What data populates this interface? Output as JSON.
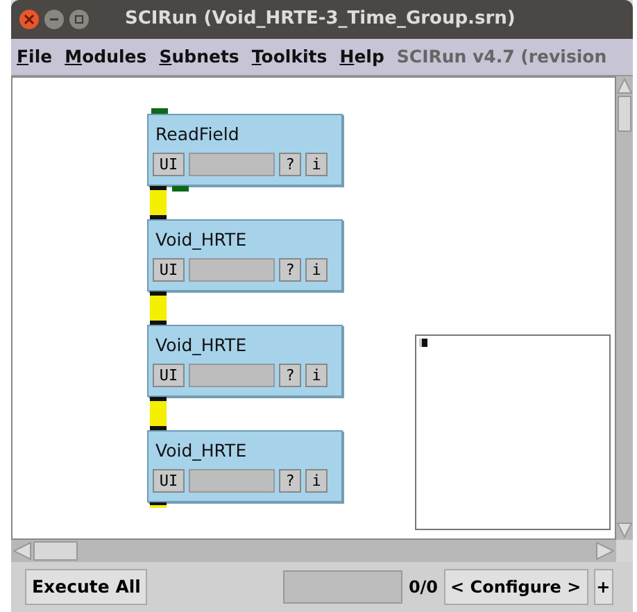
{
  "window": {
    "title": "SCIRun (Void_HRTE-3_Time_Group.srn)"
  },
  "menu": [
    {
      "label": "File"
    },
    {
      "label": "Modules"
    },
    {
      "label": "Subnets"
    },
    {
      "label": "Toolkits"
    },
    {
      "label": "Help"
    }
  ],
  "version": "SCIRun v4.7 (revision",
  "modules": [
    {
      "title": "ReadField",
      "ui": "UI",
      "help": "?",
      "info": "i"
    },
    {
      "title": "Void_HRTE",
      "ui": "UI",
      "help": "?",
      "info": "i"
    },
    {
      "title": "Void_HRTE",
      "ui": "UI",
      "help": "?",
      "info": "i"
    },
    {
      "title": "Void_HRTE",
      "ui": "UI",
      "help": "?",
      "info": "i"
    }
  ],
  "bottom": {
    "execute": "Execute All",
    "counter": "0/0",
    "configure": "< Configure >",
    "plus": "+"
  }
}
